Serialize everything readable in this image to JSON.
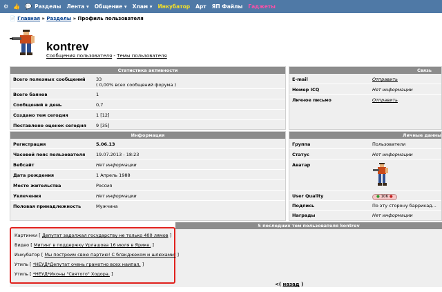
{
  "nav": {
    "items": [
      {
        "label": "Разделы",
        "color": "#ffffff"
      },
      {
        "label": "Лента ▾",
        "color": "#ffffff"
      },
      {
        "label": "Общение ▾",
        "color": "#ffffff"
      },
      {
        "label": "Хлам ▾",
        "color": "#ffffff"
      },
      {
        "label": "Инкубатор",
        "color": "#f3e02a"
      },
      {
        "label": "Арт",
        "color": "#ffffff"
      },
      {
        "label": "ЯП Файлы",
        "color": "#ffffff"
      },
      {
        "label": "Гаджеты",
        "color": "#ff4fa8"
      }
    ]
  },
  "breadcrumb": {
    "home": "Главная",
    "sep1": "»",
    "sections": "Разделы",
    "sep2": "»",
    "current": "Профиль пользователя"
  },
  "profile": {
    "username": "kontrev",
    "link_posts": "Сообщения пользователя",
    "link_sep": " - ",
    "link_topics": "Темы пользователя"
  },
  "stats": {
    "title": "Статистика активности",
    "rows": [
      {
        "label": "Всего полезных сообщений",
        "value": "33",
        "note": "( 0,00% всех сообщений форума )"
      },
      {
        "label": "Всего баянов",
        "value": "1"
      },
      {
        "label": "Сообщений в день",
        "value": "0,7"
      },
      {
        "label": "Создано тем сегодня",
        "value": "1 [12]"
      },
      {
        "label": "Поставлено оценок сегодня",
        "value": "9 [35]"
      }
    ]
  },
  "contact": {
    "title": "Связь",
    "rows": [
      {
        "label": "E-mail",
        "value": "Отправить"
      },
      {
        "label": "Номер ICQ",
        "value": "Нет информации"
      },
      {
        "label": "Личное письмо",
        "value": "Отправить"
      }
    ]
  },
  "info": {
    "title": "Информация",
    "rows": [
      {
        "label": "Регистрация",
        "value": "5.06.13"
      },
      {
        "label": "Часовой пояс пользователя",
        "value": "19.07.2013 - 18:23"
      },
      {
        "label": "Вебсайт",
        "value": "Нет информации"
      },
      {
        "label": "Дата рождения",
        "value": "1 Апрель 1988"
      },
      {
        "label": "Место жительства",
        "value": "Россия"
      },
      {
        "label": "Увлечения",
        "value": "Нет информации"
      },
      {
        "label": "Половая принадлежность",
        "value": "Мужчина"
      }
    ]
  },
  "personal": {
    "title": "Личные данны",
    "rows": [
      {
        "label": "Группа",
        "value": "Пользователи"
      },
      {
        "label": "Статус",
        "value": "Нет информации"
      },
      {
        "label": "Аватар",
        "value": ""
      },
      {
        "label": "User Quality",
        "value": "106"
      },
      {
        "label": "Подпись",
        "value": "По эту сторону баррикад..."
      },
      {
        "label": "Награды",
        "value": "Нет информации"
      }
    ]
  },
  "recent": {
    "title": "5 последних тем пользователя kontrev",
    "items": [
      {
        "section": "Картинки",
        "title": "Депутат задолжал государству не только 400 лямов"
      },
      {
        "section": "Видео",
        "title": "Митинг в поддержку Урлашова 16 июля в Ярике."
      },
      {
        "section": "Инкубатор",
        "title": "Мы построим свою партию! С блэкджеком и шлюхами!"
      },
      {
        "section": "Утиль",
        "title": "*НЕУД*Депутат очень грамотно всех наипал."
      },
      {
        "section": "Утиль",
        "title": "*НЕУД*Иконы \"Святого\" Ходора."
      }
    ],
    "back_prefix": "<(",
    "back_label": "назад",
    "back_suffix": ")"
  }
}
